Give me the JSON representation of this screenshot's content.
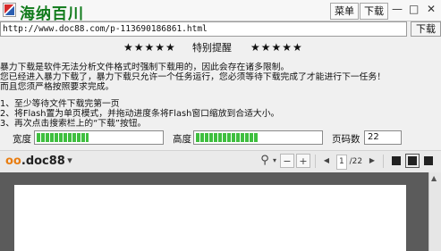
{
  "titlebar": {
    "app_name": "海纳百川",
    "menu_label": "菜单",
    "download_label": "下载",
    "minimize_glyph": "—",
    "maximize_glyph": "□",
    "close_glyph": "✕"
  },
  "urlbar": {
    "url": "http://www.doc88.com/p-113690186861.html",
    "download_button": "下载"
  },
  "notice": {
    "stars_left": "★★★★★",
    "title": "特别提醒",
    "stars_right": "★★★★★",
    "lines": [
      "暴力下载是软件无法分析文件格式时强制下载用的，因此会存在诸多限制。",
      "您已经进入暴力下载了，暴力下载只允许一个任务运行，您必须等待下载完成了才能进行下一任务！",
      "而且您须严格按照要求完成。",
      "1、至少等待文件下载完第一页",
      "2、将Flash置为单页模式，并拖动进度条将Flash窗口缩放到合适大小。",
      "3、再次点击搜索栏上的“下载”按钮。"
    ]
  },
  "controls": {
    "width_label": "宽度",
    "width_progress": 0.42,
    "height_label": "高度",
    "height_progress": 0.5,
    "pages_label": "页码数",
    "pages_value": "22"
  },
  "viewer": {
    "logo_prefix": "oo",
    "logo_text": ".doc88",
    "zoom_out": "−",
    "zoom_in": "+",
    "page_current": "1",
    "page_total": "/22",
    "prev_glyph": "◀",
    "next_glyph": "▶",
    "dropdown_glyph": "▾",
    "search_glyph": "⚲"
  },
  "colors": {
    "title_green": "#0f7a1a",
    "progress_green": "#3fbf3f",
    "logo_orange": "#e87d12",
    "doc_background": "#5b5b5b"
  }
}
